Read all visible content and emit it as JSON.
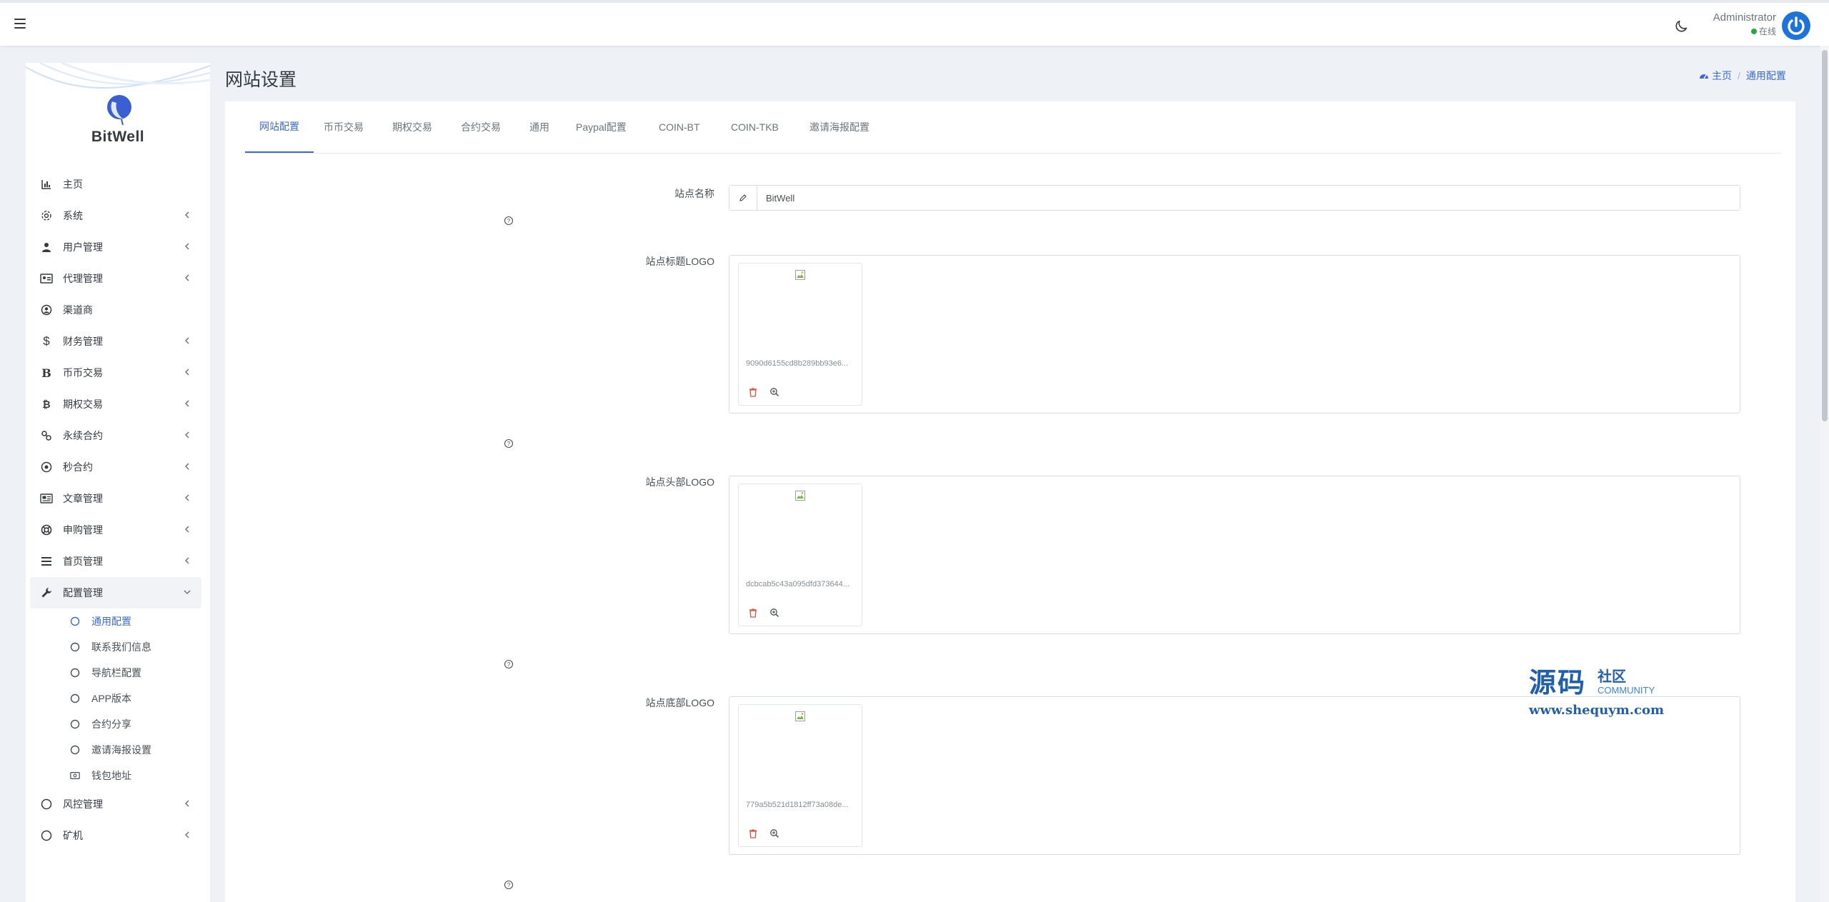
{
  "header": {
    "user_name": "Administrator",
    "user_status": "在线",
    "colors": {
      "accent": "#3b6ad6",
      "status_online": "#28a745",
      "avatar": "#1e73d8"
    }
  },
  "sidebar": {
    "brand": "BitWell",
    "items": [
      {
        "label": "主页",
        "icon": "bar-chart-icon",
        "has_children": false
      },
      {
        "label": "系统",
        "icon": "gear-icon",
        "has_children": true
      },
      {
        "label": "用户管理",
        "icon": "user-icon",
        "has_children": true
      },
      {
        "label": "代理管理",
        "icon": "id-card-icon",
        "has_children": true
      },
      {
        "label": "渠道商",
        "icon": "user-circle-icon",
        "has_children": false
      },
      {
        "label": "财务管理",
        "icon": "dollar-icon",
        "has_children": true
      },
      {
        "label": "币币交易",
        "icon": "bitcoin-b-icon",
        "has_children": true
      },
      {
        "label": "期权交易",
        "icon": "bitcoin-icon",
        "has_children": true
      },
      {
        "label": "永续合约",
        "icon": "link-icon",
        "has_children": true
      },
      {
        "label": "秒合约",
        "icon": "dot-circle-icon",
        "has_children": true
      },
      {
        "label": "文章管理",
        "icon": "newspaper-icon",
        "has_children": true
      },
      {
        "label": "申购管理",
        "icon": "life-ring-icon",
        "has_children": true
      },
      {
        "label": "首页管理",
        "icon": "list-icon",
        "has_children": true
      },
      {
        "label": "配置管理",
        "icon": "wrench-icon",
        "has_children": true,
        "open": true
      },
      {
        "label": "风控管理",
        "icon": "circle-icon",
        "has_children": true
      },
      {
        "label": "矿机",
        "icon": "circle-icon",
        "has_children": true
      }
    ],
    "submenu": [
      {
        "label": "通用配置",
        "icon": "circle-outline-icon",
        "active": true
      },
      {
        "label": "联系我们信息",
        "icon": "circle-outline-icon"
      },
      {
        "label": "导航栏配置",
        "icon": "circle-outline-icon"
      },
      {
        "label": "APP版本",
        "icon": "circle-outline-icon"
      },
      {
        "label": "合约分享",
        "icon": "circle-outline-icon"
      },
      {
        "label": "邀请海报设置",
        "icon": "circle-outline-icon"
      },
      {
        "label": "钱包地址",
        "icon": "money-bill-icon"
      }
    ]
  },
  "page": {
    "title": "网站设置",
    "breadcrumb": {
      "home": "主页",
      "current": "通用配置"
    }
  },
  "tabs": [
    "网站配置",
    "币币交易",
    "期权交易",
    "合约交易",
    "通用",
    "Paypal配置",
    "COIN-BT",
    "COIN-TKB",
    "邀请海报配置"
  ],
  "form": {
    "site_name": {
      "label": "站点名称",
      "value": "BitWell"
    },
    "title_logo": {
      "label": "站点标题LOGO",
      "filename": "9090d6155cd8b289bb93e6..."
    },
    "header_logo": {
      "label": "站点头部LOGO",
      "filename": "dcbcab5c43a095dfd373644..."
    },
    "footer_logo": {
      "label": "站点底部LOGO",
      "filename": "779a5b521d1812ff73a08de..."
    }
  },
  "watermark": {
    "big": "源码",
    "small1": "社区",
    "small2": "COMMUNITY",
    "url": "www.shequym.com"
  }
}
